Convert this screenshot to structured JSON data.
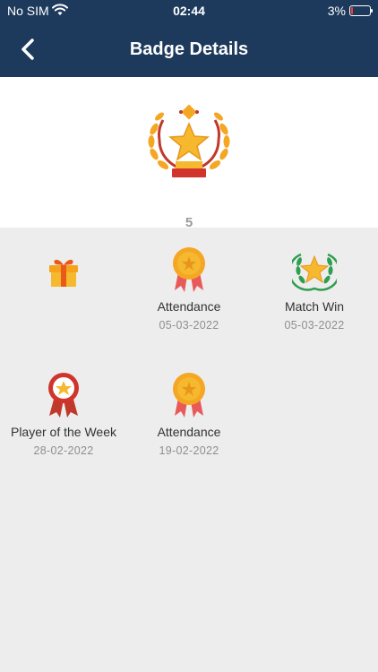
{
  "status": {
    "carrier": "No SIM",
    "time": "02:44",
    "battery": "3%"
  },
  "header": {
    "title": "Badge Details",
    "back_icon": "chevron-left-icon"
  },
  "summary": {
    "count": "5",
    "icon": "laurel-trophy-icon"
  },
  "badges": [
    {
      "name": "",
      "date": "",
      "icon": "gift-icon"
    },
    {
      "name": "Attendance",
      "date": "05-03-2022",
      "icon": "medal-icon"
    },
    {
      "name": "Match Win",
      "date": "05-03-2022",
      "icon": "laurel-star-icon"
    },
    {
      "name": "Player of the Week",
      "date": "28-02-2022",
      "icon": "rosette-icon"
    },
    {
      "name": "Attendance",
      "date": "19-02-2022",
      "icon": "medal-icon"
    }
  ],
  "colors": {
    "header_bg": "#1d3a5c",
    "body_bg": "#ededed"
  }
}
